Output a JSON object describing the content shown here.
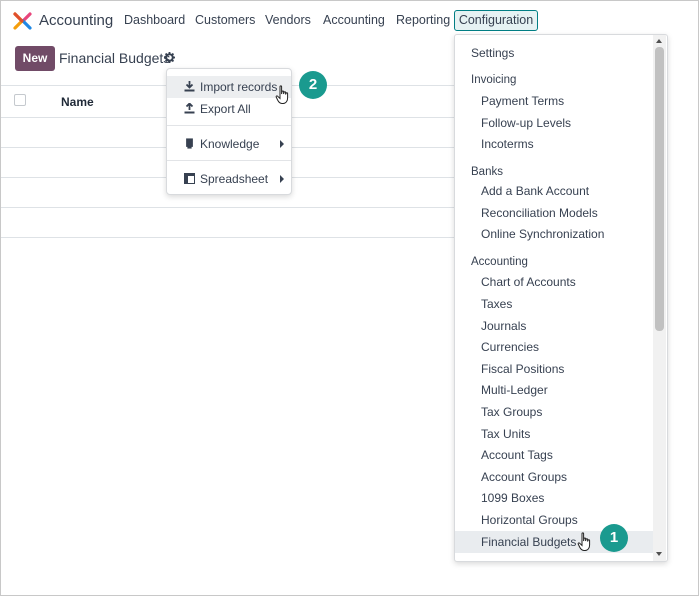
{
  "app": {
    "name": "Accounting"
  },
  "nav": {
    "items": [
      "Dashboard",
      "Customers",
      "Vendors",
      "Accounting",
      "Reporting"
    ],
    "active": "Configuration"
  },
  "control_panel": {
    "new_label": "New",
    "title": "Financial Budgets"
  },
  "list": {
    "column_name": "Name"
  },
  "gear_menu": {
    "import": "Import records",
    "export": "Export All",
    "knowledge": "Knowledge",
    "spreadsheet": "Spreadsheet"
  },
  "config_menu": {
    "settings": "Settings",
    "invoicing_header": "Invoicing",
    "invoicing": [
      "Payment Terms",
      "Follow-up Levels",
      "Incoterms"
    ],
    "banks_header": "Banks",
    "banks": [
      "Add a Bank Account",
      "Reconciliation Models",
      "Online Synchronization"
    ],
    "accounting_header": "Accounting",
    "accounting": [
      "Chart of Accounts",
      "Taxes",
      "Journals",
      "Currencies",
      "Fiscal Positions",
      "Multi-Ledger",
      "Tax Groups",
      "Tax Units",
      "Account Tags",
      "Account Groups",
      "1099 Boxes",
      "Horizontal Groups",
      "Financial Budgets"
    ]
  },
  "badges": {
    "step1": "1",
    "step2": "2"
  },
  "colors": {
    "brand": "#714b67",
    "accent": "#017e84",
    "badge": "#1a9a8f"
  }
}
